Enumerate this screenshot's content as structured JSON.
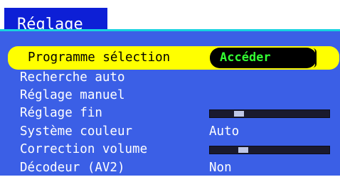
{
  "menu": {
    "title": "Réglage",
    "highlighted": {
      "label": "Programme sélection",
      "action": "Accéder"
    },
    "items": [
      {
        "label": "Recherche auto",
        "value": ""
      },
      {
        "label": "Réglage manuel",
        "value": ""
      },
      {
        "label": "Réglage fin",
        "value": "",
        "slider_level": 0.22
      },
      {
        "label": "Système couleur",
        "value": "Auto"
      },
      {
        "label": "Correction volume",
        "value": "",
        "slider_level": 0.26
      },
      {
        "label": "Décodeur (AV2)",
        "value": "Non"
      }
    ]
  },
  "colors": {
    "panel": "#3b5fe6",
    "title_bg": "#0d1fd6",
    "highlight": "#ffff00",
    "action_text": "#33ff33"
  }
}
